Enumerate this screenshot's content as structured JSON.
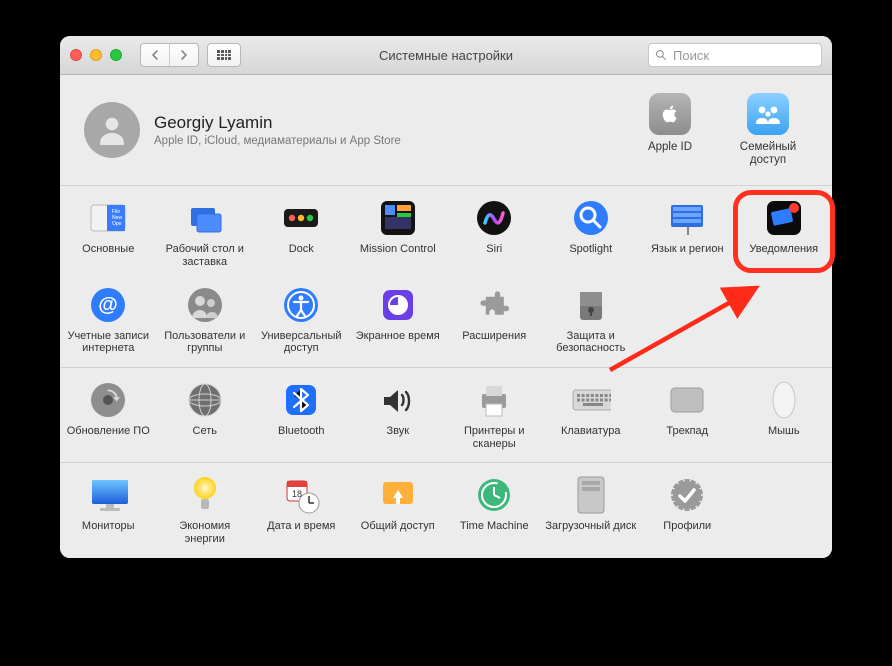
{
  "window": {
    "title": "Системные настройки",
    "search_placeholder": "Поиск"
  },
  "account": {
    "name": "Georgiy Lyamin",
    "subtitle": "Apple ID, iCloud, медиаматериалы и App Store",
    "right": [
      {
        "label": "Apple ID",
        "icon": "apple"
      },
      {
        "label": "Семейный доступ",
        "icon": "family"
      }
    ]
  },
  "rows": [
    [
      {
        "label": "Основные",
        "icon": "general"
      },
      {
        "label": "Рабочий стол и заставка",
        "icon": "desktop"
      },
      {
        "label": "Dock",
        "icon": "dock"
      },
      {
        "label": "Mission Control",
        "icon": "mission"
      },
      {
        "label": "Siri",
        "icon": "siri"
      },
      {
        "label": "Spotlight",
        "icon": "spotlight"
      },
      {
        "label": "Язык и регион",
        "icon": "language"
      },
      {
        "label": "Уведомления",
        "icon": "notifications",
        "highlighted": true
      }
    ],
    [
      {
        "label": "Учетные записи интернета",
        "icon": "internet-accounts"
      },
      {
        "label": "Пользователи и группы",
        "icon": "users"
      },
      {
        "label": "Универсальный доступ",
        "icon": "accessibility"
      },
      {
        "label": "Экранное время",
        "icon": "screentime"
      },
      {
        "label": "Расширения",
        "icon": "extensions"
      },
      {
        "label": "Защита и безопасность",
        "icon": "security"
      }
    ],
    [
      {
        "label": "Обновление ПО",
        "icon": "software-update"
      },
      {
        "label": "Сеть",
        "icon": "network"
      },
      {
        "label": "Bluetooth",
        "icon": "bluetooth"
      },
      {
        "label": "Звук",
        "icon": "sound"
      },
      {
        "label": "Принтеры и сканеры",
        "icon": "printers"
      },
      {
        "label": "Клавиатура",
        "icon": "keyboard"
      },
      {
        "label": "Трекпад",
        "icon": "trackpad"
      },
      {
        "label": "Мышь",
        "icon": "mouse"
      }
    ],
    [
      {
        "label": "Мониторы",
        "icon": "displays"
      },
      {
        "label": "Экономия энергии",
        "icon": "energy"
      },
      {
        "label": "Дата и время",
        "icon": "datetime"
      },
      {
        "label": "Общий доступ",
        "icon": "sharing"
      },
      {
        "label": "Time Machine",
        "icon": "timemachine"
      },
      {
        "label": "Загрузочный диск",
        "icon": "startup-disk"
      },
      {
        "label": "Профили",
        "icon": "profiles"
      }
    ]
  ]
}
